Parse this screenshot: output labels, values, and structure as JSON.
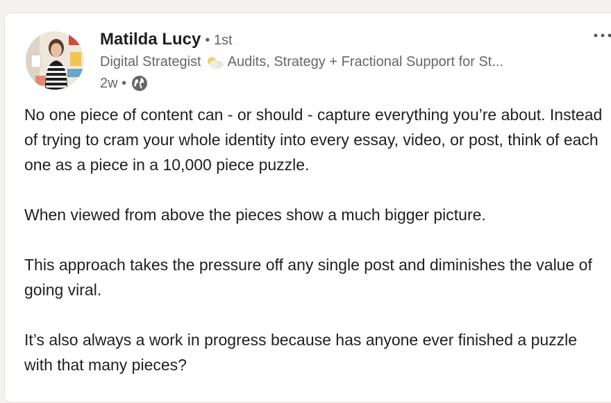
{
  "post": {
    "author": {
      "name": "Matilda Lucy",
      "degree": "• 1st",
      "headline_start": "Digital Strategist",
      "headline_icon": "sun-behind-cloud-emoji",
      "headline_end": "Audits, Strategy + Fractional Support for St...",
      "time": "2w •",
      "visibility_icon": "globe-icon"
    },
    "menu_icon": "more-options-icon",
    "paragraphs": [
      "No one piece of content can - or should - capture everything you’re about. Instead of trying to cram your whole identity into every essay, video, or post, think of each one as a piece in a 10,000 piece puzzle.",
      "When viewed from above the pieces show a much bigger picture.",
      "This approach takes the pressure off any single post and diminishes the value of going viral.",
      "It’s also always a work in progress because has anyone ever finished a puzzle with that many pieces?"
    ]
  },
  "colors": {
    "text_primary": "#1f1f1f",
    "text_secondary": "#666666",
    "card_background": "#ffffff",
    "page_background": "#f4f2ee"
  }
}
